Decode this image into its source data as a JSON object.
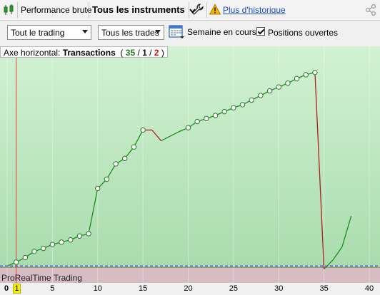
{
  "toolbar": {
    "view_label": "Performance brute",
    "instrument_label": "Tous les instruments",
    "history_link": "Plus d'historique"
  },
  "filters": {
    "trading_select": "Tout le trading",
    "trades_select": "Tous les trades",
    "period_label": "Semaine en cours",
    "open_positions_label": "Positions ouvertes",
    "open_positions_checked": true
  },
  "chart_panel": {
    "axis_prefix": "Axe horizontal: ",
    "axis_name": "Transactions",
    "count_green": "35",
    "count_black": "1",
    "count_red": "2",
    "sep1": " / ",
    "sep2": " / ",
    "paren_open": "( ",
    "paren_close": " )",
    "watermark": "ProRealTime Trading",
    "cursor_value": "1"
  },
  "colors": {
    "gain_fill": "#c8ecc8",
    "loss_fill": "#d7bcc4",
    "line_up": "#1f8a1f",
    "line_down": "#b01e1e",
    "zero_line": "#3b3bd9"
  },
  "chart_data": {
    "type": "line",
    "xlabel": "Transactions",
    "xlim": [
      0,
      40
    ],
    "x_ticks": [
      "0",
      "5",
      "10",
      "15",
      "20",
      "25",
      "30",
      "35",
      "40"
    ],
    "equity": [
      {
        "x": 0,
        "y": 0,
        "m": false
      },
      {
        "x": 1,
        "y": 0.5,
        "m": true
      },
      {
        "x": 2,
        "y": 1.1,
        "m": true
      },
      {
        "x": 3,
        "y": 1.9,
        "m": true
      },
      {
        "x": 4,
        "y": 2.3,
        "m": true
      },
      {
        "x": 5,
        "y": 2.8,
        "m": true
      },
      {
        "x": 6,
        "y": 3.1,
        "m": true
      },
      {
        "x": 7,
        "y": 3.4,
        "m": true
      },
      {
        "x": 8,
        "y": 3.9,
        "m": true
      },
      {
        "x": 9,
        "y": 4.2,
        "m": true
      },
      {
        "x": 10,
        "y": 10.1,
        "m": true
      },
      {
        "x": 11,
        "y": 11.3,
        "m": true
      },
      {
        "x": 12,
        "y": 13.3,
        "m": true
      },
      {
        "x": 13,
        "y": 14.0,
        "m": true
      },
      {
        "x": 14,
        "y": 15.5,
        "m": true
      },
      {
        "x": 15,
        "y": 17.7,
        "m": true
      },
      {
        "x": 16,
        "y": 17.7,
        "m": false
      },
      {
        "x": 17,
        "y": 16.3,
        "m": false
      },
      {
        "x": 19,
        "y": 17.5,
        "m": false
      },
      {
        "x": 20,
        "y": 18.0,
        "m": true
      },
      {
        "x": 21,
        "y": 18.8,
        "m": true
      },
      {
        "x": 22,
        "y": 19.2,
        "m": true
      },
      {
        "x": 23,
        "y": 19.6,
        "m": true
      },
      {
        "x": 24,
        "y": 20.1,
        "m": true
      },
      {
        "x": 25,
        "y": 20.6,
        "m": true
      },
      {
        "x": 26,
        "y": 21.0,
        "m": true
      },
      {
        "x": 27,
        "y": 21.6,
        "m": true
      },
      {
        "x": 28,
        "y": 22.2,
        "m": true
      },
      {
        "x": 29,
        "y": 22.8,
        "m": true
      },
      {
        "x": 30,
        "y": 23.3,
        "m": true
      },
      {
        "x": 31,
        "y": 23.8,
        "m": true
      },
      {
        "x": 32,
        "y": 24.4,
        "m": true
      },
      {
        "x": 33,
        "y": 24.9,
        "m": true
      },
      {
        "x": 34,
        "y": 25.2,
        "m": true
      },
      {
        "x": 35,
        "y": -0.4,
        "m": false
      },
      {
        "x": 36,
        "y": 0.8,
        "m": false
      },
      {
        "x": 37,
        "y": 2.5,
        "m": false
      },
      {
        "x": 38,
        "y": 6.5,
        "m": false
      }
    ],
    "down_segments": [
      [
        15,
        16
      ],
      [
        16,
        17
      ],
      [
        34,
        35
      ]
    ],
    "ylim": [
      -2.2,
      28.6
    ]
  }
}
